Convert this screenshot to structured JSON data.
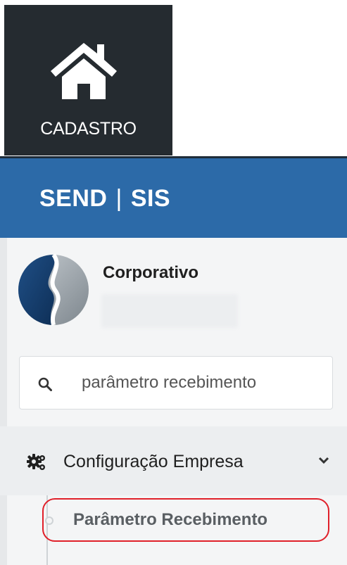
{
  "tile": {
    "label": "CADASTRO",
    "icon": "home-icon"
  },
  "brand": {
    "left": "SEND",
    "separator": "|",
    "right": "SIS"
  },
  "profile": {
    "company_name": "Corporativo"
  },
  "search": {
    "value": "parâmetro recebimento",
    "icon": "search-icon"
  },
  "menu": {
    "group_label": "Configuração Empresa",
    "group_icon": "gears-icon",
    "items": [
      {
        "label": "Parâmetro Recebimento",
        "highlighted": true
      }
    ]
  },
  "colors": {
    "tile_bg": "#252b30",
    "brand_bar": "#2c6aa8",
    "highlight_border": "#e0202a"
  }
}
